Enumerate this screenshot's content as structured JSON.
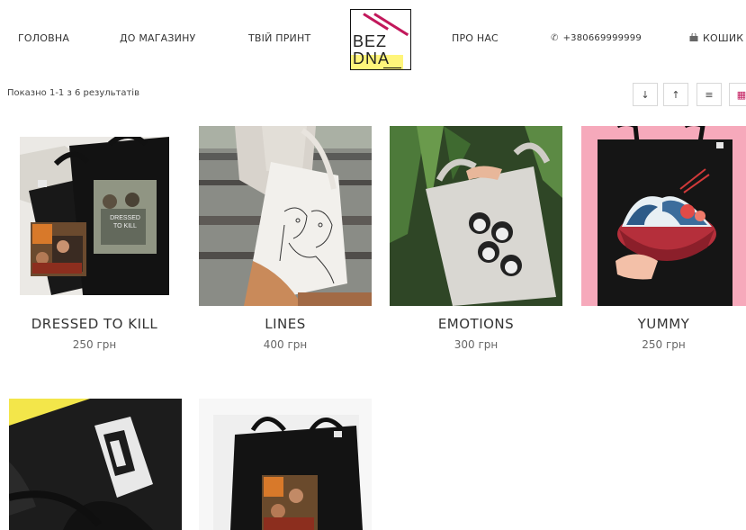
{
  "nav": {
    "home": "ГОЛОВНА",
    "shop": "ДО МАГАЗИНУ",
    "print": "ТВІЙ ПРИНТ",
    "about": "ПРО НАС",
    "phone": "+380669999999",
    "cart": "КОШИК"
  },
  "logo": {
    "line1": "BEZ",
    "line2": "DNA",
    "accent": "#c2185b",
    "highlight": "#fff57a"
  },
  "toolbar": {
    "results": "Показно 1-1 з 6 результатів",
    "sort_desc_icon": "↓",
    "sort_asc_icon": "↑",
    "list_icon": "≡",
    "grid_icon": "▦"
  },
  "products": [
    {
      "title": "DRESSED TO KILL",
      "price": "250 грн",
      "print_text": "DRESSED TO KILL"
    },
    {
      "title": "LINES",
      "price": "400 грн"
    },
    {
      "title": "EMOTIONS",
      "price": "300 грн"
    },
    {
      "title": "YUMMY",
      "price": "250 грн"
    },
    {
      "title": "",
      "price": ""
    },
    {
      "title": "",
      "price": ""
    }
  ],
  "icons": {
    "phone": "phone-icon",
    "cart": "bag-icon"
  }
}
